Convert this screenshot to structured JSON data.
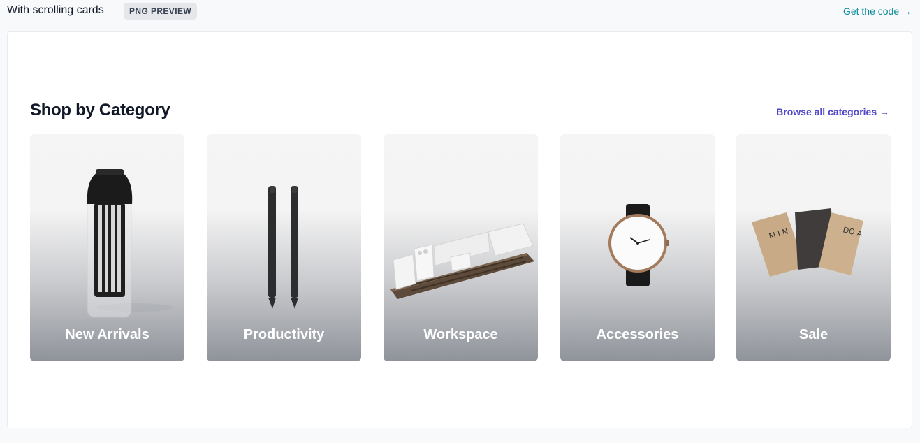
{
  "header": {
    "title": "With scrolling cards",
    "badge": "PNG PREVIEW",
    "code_link": "Get the code →"
  },
  "section": {
    "title": "Shop by Category",
    "browse_link": "Browse all categories →"
  },
  "categories": [
    {
      "label": "New Arrivals",
      "image": "carafe-image"
    },
    {
      "label": "Productivity",
      "image": "pens-image"
    },
    {
      "label": "Workspace",
      "image": "desk-organizer-image"
    },
    {
      "label": "Accessories",
      "image": "watch-image"
    },
    {
      "label": "Sale",
      "image": "notebooks-image"
    }
  ],
  "colors": {
    "accent_link": "#4f46c9",
    "code_link": "#0d8a9a",
    "heading": "#111827"
  }
}
